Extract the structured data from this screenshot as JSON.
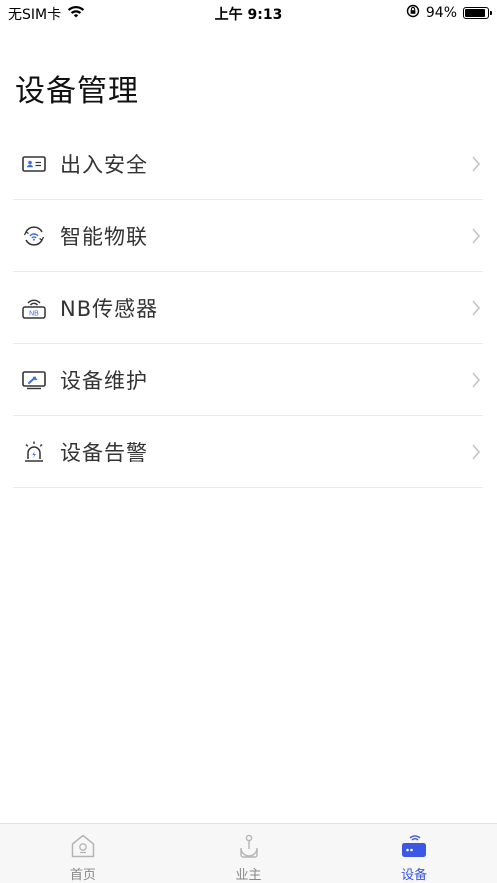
{
  "status_bar": {
    "carrier": "无SIM卡",
    "time": "上午 9:13",
    "battery_percent": "94%",
    "battery_level": 0.94,
    "icons": [
      "wifi-icon",
      "orientation-lock-icon",
      "battery-icon"
    ]
  },
  "page": {
    "title": "设备管理"
  },
  "menu": {
    "items": [
      {
        "label": "出入安全",
        "icon": "id-card-icon"
      },
      {
        "label": "智能物联",
        "icon": "smart-iot-icon"
      },
      {
        "label": "NB传感器",
        "icon": "nb-sensor-icon"
      },
      {
        "label": "设备维护",
        "icon": "maintenance-icon"
      },
      {
        "label": "设备告警",
        "icon": "alarm-light-icon"
      }
    ]
  },
  "tab_bar": {
    "tabs": [
      {
        "label": "首页",
        "icon": "home-icon",
        "active": false
      },
      {
        "label": "业主",
        "icon": "owner-icon",
        "active": false
      },
      {
        "label": "设备",
        "icon": "device-icon",
        "active": true
      }
    ]
  },
  "colors": {
    "accent": "#3b57e3",
    "icon_blue": "#3b6fe0",
    "icon_dark": "#333333",
    "inactive": "#888888"
  }
}
